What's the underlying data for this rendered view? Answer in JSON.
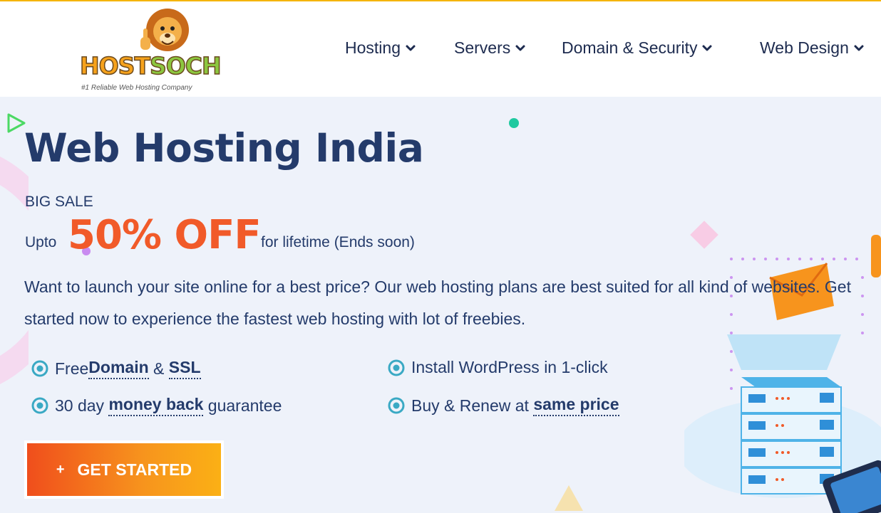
{
  "header": {
    "logo": {
      "word_part1": "HOST",
      "word_part2": "SOCH",
      "tagline": "#1 Reliable Web Hosting Company"
    },
    "nav": [
      {
        "label": "Hosting",
        "icon": "chevron-down-icon"
      },
      {
        "label": "Servers",
        "icon": "chevron-down-icon"
      },
      {
        "label": "Domain & Security",
        "icon": "chevron-down-icon"
      },
      {
        "label": "Web Design",
        "icon": "chevron-down-icon"
      }
    ]
  },
  "hero": {
    "title": "Web Hosting India",
    "sale_label": "BIG SALE",
    "offer_prefix": "Upto",
    "offer_value": "50% OFF",
    "offer_suffix": "for lifetime (Ends soon)",
    "description": "Want to launch your site online for a best price? Our web hosting plans are best suited for all kind of websites. Get started now to experience the fastest web hosting with lot of freebies.",
    "features": [
      {
        "icon": "target-bullet-icon",
        "parts": [
          "Free ",
          "Domain",
          " & ",
          "SSL"
        ]
      },
      {
        "icon": "target-bullet-icon",
        "text": "Install WordPress in 1-click"
      },
      {
        "icon": "target-bullet-icon",
        "parts": [
          "30 day ",
          "money back",
          " guarantee"
        ]
      },
      {
        "icon": "target-bullet-icon",
        "parts": [
          "Buy & Renew at ",
          "same price"
        ]
      }
    ],
    "cta": {
      "icon": "plus",
      "label": "GET STARTED"
    }
  },
  "colors": {
    "accent_orange": "#f15a29",
    "title_navy": "#243b6b",
    "feature_icon_teal": "#3aa9c4",
    "top_strip": "#f5b400"
  }
}
